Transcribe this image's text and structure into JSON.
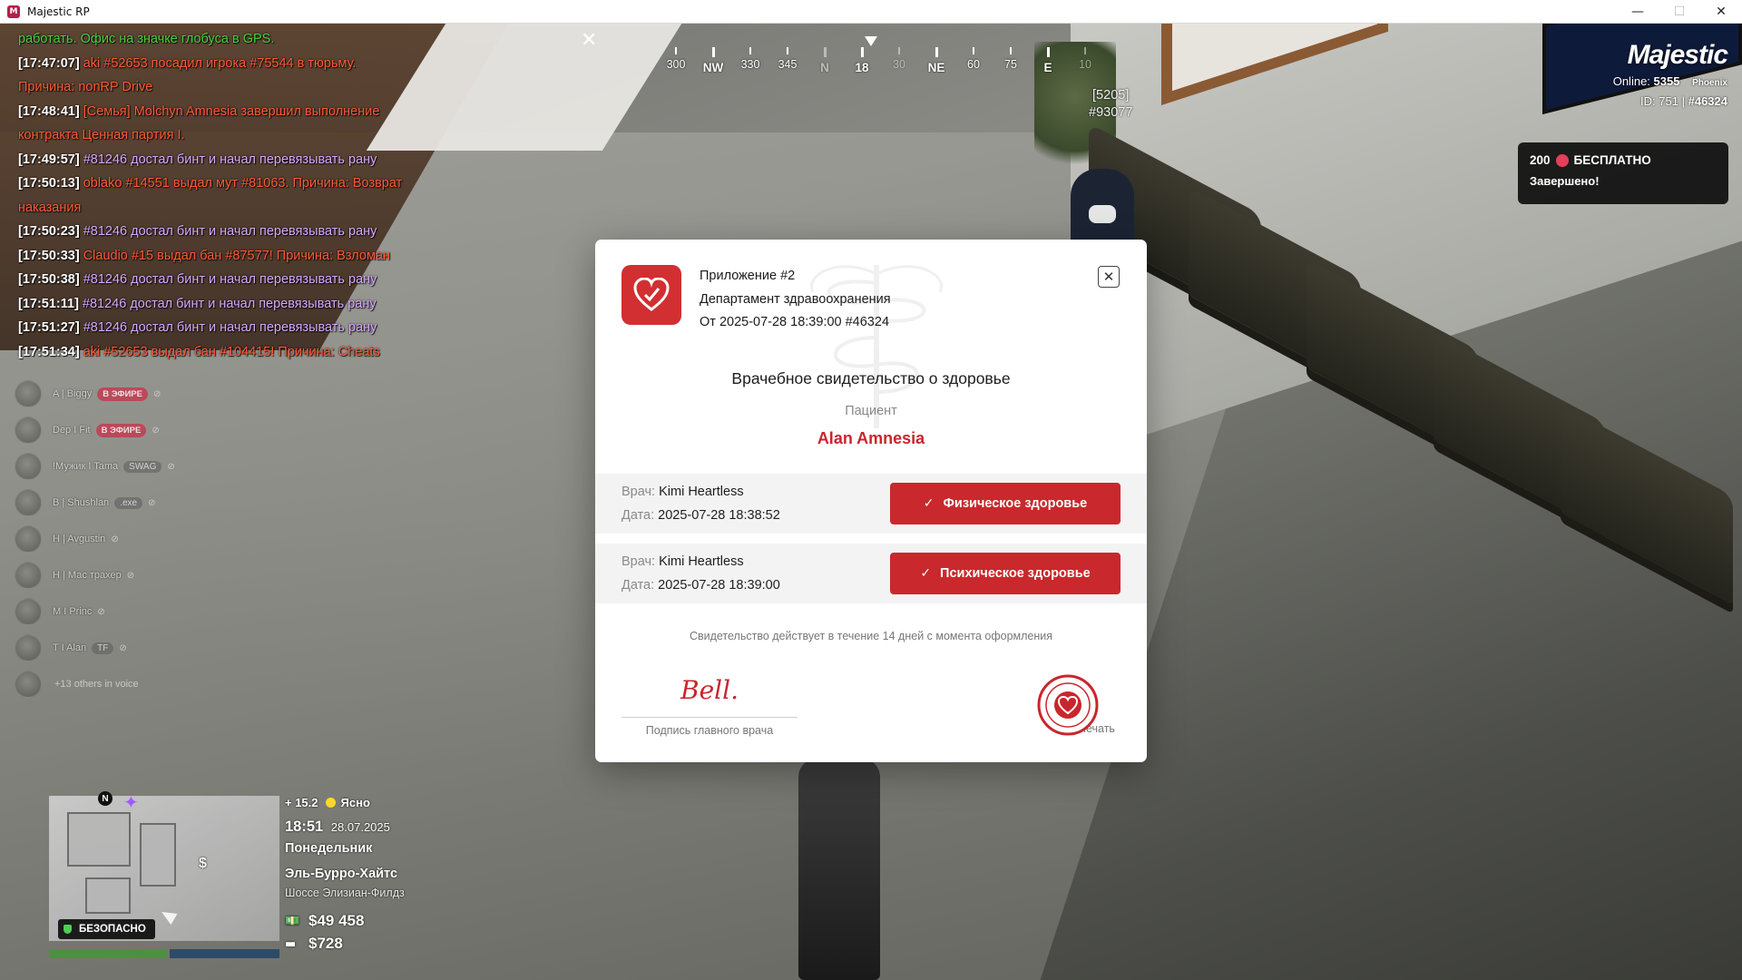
{
  "window": {
    "title": "Majestic RP",
    "minimize": "—",
    "maximize": "☐",
    "close": "✕"
  },
  "chat": [
    {
      "ts": "",
      "text": "работать. Офис на значке глобуса в GPS.",
      "style": "green"
    },
    {
      "ts": "[17:47:07]",
      "text": "aki #52653 посадил игрока #75544 в тюрьму.",
      "style": "red"
    },
    {
      "ts": "",
      "text": "Причина: nonRP Drive",
      "style": "red"
    },
    {
      "ts": "[17:48:41]",
      "text": "[Семья] Molchyn Amnesia завершил выполнение",
      "style": "red"
    },
    {
      "ts": "",
      "text": "контракта Ценная партия I.",
      "style": "red"
    },
    {
      "ts": "[17:49:57]",
      "text": "#81246 достал бинт и начал перевязывать рану",
      "style": "purple"
    },
    {
      "ts": "[17:50:13]",
      "text": "oblako #14551 выдал мут #81063. Причина: Возврат",
      "style": "red"
    },
    {
      "ts": "",
      "text": "наказания",
      "style": "red"
    },
    {
      "ts": "[17:50:23]",
      "text": "#81246 достал бинт и начал перевязывать рану",
      "style": "purple"
    },
    {
      "ts": "[17:50:33]",
      "text": "Claudio #15 выдал бан #87577! Причина: Взломан",
      "style": "red"
    },
    {
      "ts": "[17:50:38]",
      "text": "#81246 достал бинт и начал перевязывать рану",
      "style": "purple"
    },
    {
      "ts": "[17:51:11]",
      "text": "#81246 достал бинт и начал перевязывать рану",
      "style": "purple"
    },
    {
      "ts": "[17:51:27]",
      "text": "#81246 достал бинт и начал перевязывать рану",
      "style": "purple"
    },
    {
      "ts": "[17:51:34]",
      "text": "aki #52653 выдал бан #104415! Причина: Cheats",
      "style": "red"
    }
  ],
  "voice": {
    "members": [
      {
        "name": "A | Biggy",
        "badge": "В ЭФИРЕ",
        "tag": ""
      },
      {
        "name": "Dep I Fit",
        "badge": "В ЭФИРЕ",
        "tag": ""
      },
      {
        "name": "!Мужик I Tama",
        "badge": "",
        "tag": "SWAG"
      },
      {
        "name": "B | Shushlan",
        "badge": "",
        "tag": ".exe"
      },
      {
        "name": "H | Avgustin",
        "badge": "",
        "tag": ""
      },
      {
        "name": "H | Мас трахер",
        "badge": "",
        "tag": ""
      },
      {
        "name": "M I Princ",
        "badge": "",
        "tag": ""
      },
      {
        "name": "T I Alan",
        "badge": "",
        "tag": "TF"
      }
    ],
    "more": "+13 others in voice"
  },
  "compass": {
    "ticks": [
      "300",
      "NW",
      "330",
      "345",
      "N",
      "18",
      "30",
      "NE",
      "60",
      "75",
      "E",
      "10"
    ],
    "heading": "18"
  },
  "hud_close": "✕",
  "player_tag": {
    "line1": "[5205]",
    "line2": "#93077"
  },
  "brand": {
    "logo": "Majestic",
    "online_label": "Online:",
    "online_count": "5355",
    "server": "Phoenix",
    "id_label": "ID:",
    "id_value": "751",
    "id_static": "#46324"
  },
  "notification": {
    "amount": "200",
    "label": "БЕСПЛАТНО",
    "status": "Завершено!"
  },
  "minimap": {
    "north": "N",
    "safe_zone": "БЕЗОПАСНО",
    "health_pct": 100,
    "armor_pct": 100
  },
  "hud_info": {
    "temperature": "+ 15.2",
    "weather": "Ясно",
    "time": "18:51",
    "date": "28.07.2025",
    "weekday": "Понедельник",
    "district": "Эль-Бурро-Хайтс",
    "street": "Шоссе Элизиан-Филдз",
    "cash": "$49 458",
    "bank": "$728"
  },
  "modal": {
    "app": "Приложение #2",
    "department": "Департамент здравоохранения",
    "from": "От 2025-07-28 18:39:00 #46324",
    "close": "✕",
    "title": "Врачебное свидетельство о здоровье",
    "patient_label": "Пациент",
    "patient_name": "Alan Amnesia",
    "records": [
      {
        "doctor_label": "Врач:",
        "doctor": "Kimi Heartless",
        "date_label": "Дата:",
        "date": "2025-07-28 18:38:52",
        "button": "Физическое здоровье",
        "check": "✓"
      },
      {
        "doctor_label": "Врач:",
        "doctor": "Kimi Heartless",
        "date_label": "Дата:",
        "date": "2025-07-28 18:39:00",
        "button": "Психическое здоровье",
        "check": "✓"
      }
    ],
    "validity": "Свидетельство действует в течение 14 дней с момента оформления",
    "signature": "Bell.",
    "signature_label": "Подпись главного врача",
    "stamp_label": "Печать"
  }
}
